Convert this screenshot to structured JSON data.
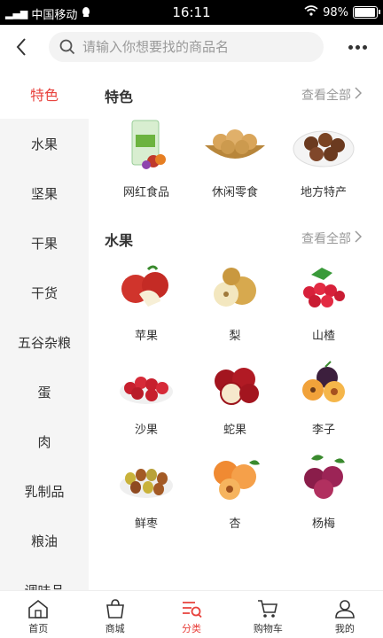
{
  "status": {
    "carrier": "中国移动",
    "time": "16:11",
    "battery": "98%"
  },
  "search": {
    "placeholder": "请输入你想要找的商品名"
  },
  "sidebar": {
    "items": [
      {
        "label": "特色",
        "active": true
      },
      {
        "label": "水果"
      },
      {
        "label": "坚果"
      },
      {
        "label": "干果"
      },
      {
        "label": "干货"
      },
      {
        "label": "五谷杂粮"
      },
      {
        "label": "蛋"
      },
      {
        "label": "肉"
      },
      {
        "label": "乳制品"
      },
      {
        "label": "粮油"
      },
      {
        "label": "调味品"
      }
    ]
  },
  "sections": [
    {
      "title": "特色",
      "more": "查看全部",
      "items": [
        {
          "label": "网红食品",
          "icon": "snack-bag-icon"
        },
        {
          "label": "休闲零食",
          "icon": "cookies-basket-icon"
        },
        {
          "label": "地方特产",
          "icon": "chestnut-plate-icon"
        }
      ]
    },
    {
      "title": "水果",
      "more": "查看全部",
      "items": [
        {
          "label": "苹果",
          "icon": "apple-icon"
        },
        {
          "label": "梨",
          "icon": "pear-icon"
        },
        {
          "label": "山楂",
          "icon": "hawthorn-icon"
        },
        {
          "label": "沙果",
          "icon": "crabapple-icon"
        },
        {
          "label": "蛇果",
          "icon": "red-delicious-icon"
        },
        {
          "label": "李子",
          "icon": "plum-icon"
        },
        {
          "label": "鲜枣",
          "icon": "jujube-icon"
        },
        {
          "label": "杏",
          "icon": "apricot-icon"
        },
        {
          "label": "杨梅",
          "icon": "bayberry-icon"
        }
      ]
    }
  ],
  "tabbar": {
    "items": [
      {
        "label": "首页",
        "icon": "home-icon"
      },
      {
        "label": "商城",
        "icon": "shop-bag-icon"
      },
      {
        "label": "分类",
        "icon": "category-icon",
        "active": true
      },
      {
        "label": "购物车",
        "icon": "cart-icon"
      },
      {
        "label": "我的",
        "icon": "user-icon"
      }
    ]
  },
  "colors": {
    "accent": "#e8423d",
    "sidebar_bg": "#f5f5f5"
  }
}
